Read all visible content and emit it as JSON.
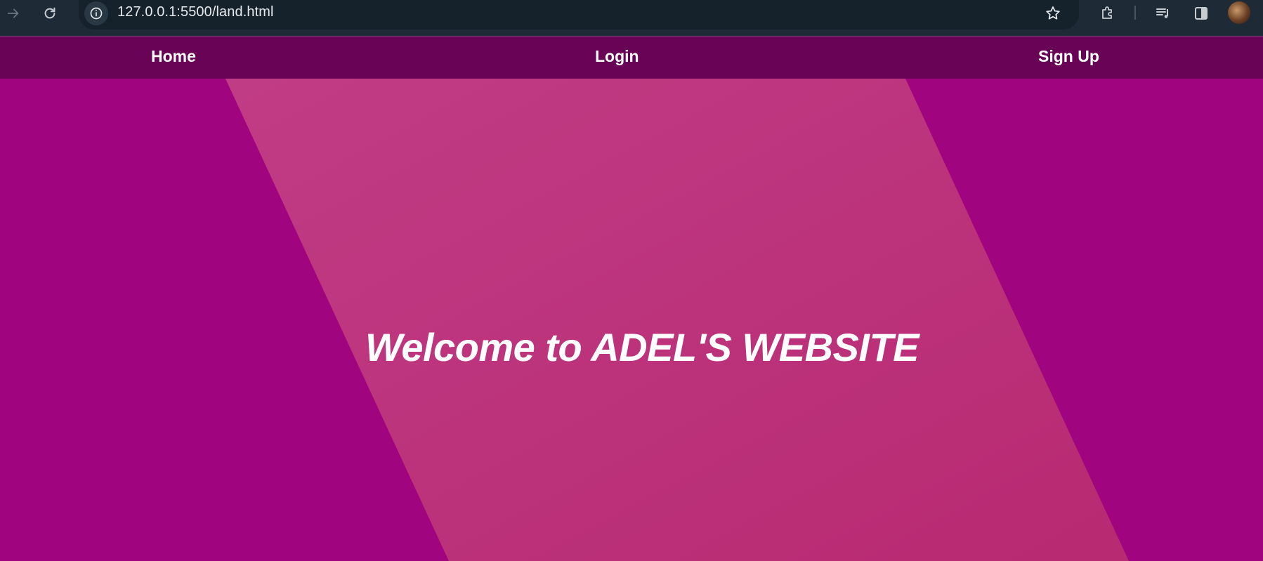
{
  "browser": {
    "url": "127.0.0.1:5500/land.html",
    "icons": {
      "forward": "forward-arrow-icon",
      "reload": "reload-icon",
      "site_info": "info-icon",
      "bookmark": "star-icon",
      "extensions": "puzzle-icon",
      "media": "media-queue-icon",
      "side_panel": "side-panel-icon",
      "profile": "avatar"
    }
  },
  "nav": {
    "home": "Home",
    "login": "Login",
    "signup": "Sign Up"
  },
  "hero": {
    "title": "Welcome to ADEL'S WEBSITE"
  },
  "colors": {
    "chrome_bg": "#1e2a35",
    "nav_bg": "#680356",
    "hero_bg": "#a0047f",
    "band_start": "#c03c85",
    "band_end": "#b82a72",
    "text": "#ffffff"
  }
}
